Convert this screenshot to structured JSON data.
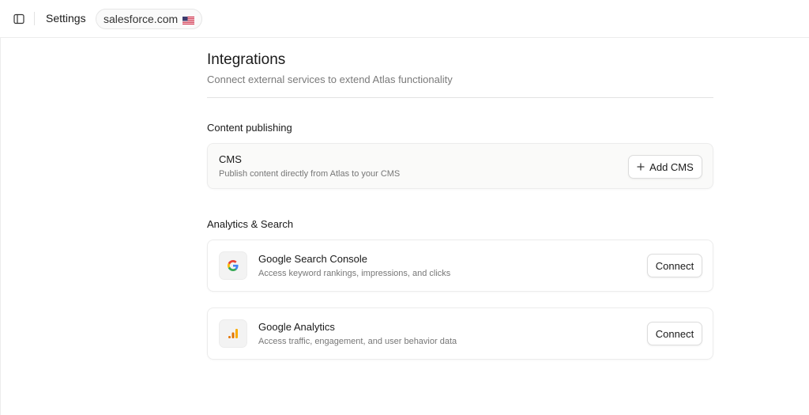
{
  "topbar": {
    "title": "Settings",
    "site": "salesforce.com",
    "flag_icon": "us-flag-icon"
  },
  "header": {
    "title": "Integrations",
    "subtitle": "Connect external services to extend Atlas functionality"
  },
  "sections": [
    {
      "title": "Content publishing",
      "cards": [
        {
          "title": "CMS",
          "description": "Publish content directly from Atlas to your CMS",
          "button_label": "Add CMS",
          "button_icon": "plus-icon"
        }
      ]
    },
    {
      "title": "Analytics & Search",
      "cards": [
        {
          "title": "Google Search Console",
          "description": "Access keyword rankings, impressions, and clicks",
          "button_label": "Connect",
          "icon": "google-icon"
        },
        {
          "title": "Google Analytics",
          "description": "Access traffic, engagement, and user behavior data",
          "button_label": "Connect",
          "icon": "google-analytics-icon"
        }
      ]
    }
  ],
  "colors": {
    "ga_orange_dark": "#E37400",
    "ga_orange_light": "#F9AB00",
    "google_blue": "#4285F4",
    "google_red": "#EA4335",
    "google_yellow": "#FBBC05",
    "google_green": "#34A853"
  }
}
